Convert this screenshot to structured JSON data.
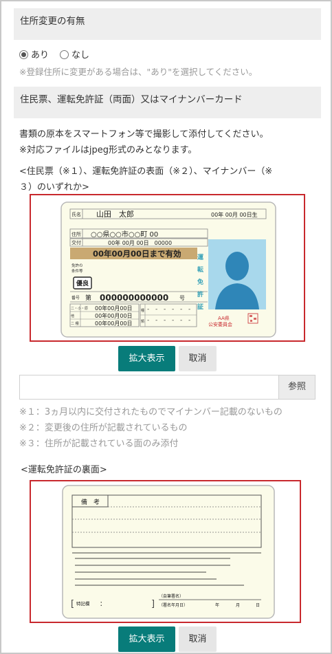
{
  "address_change": {
    "heading": "住所変更の有無",
    "options": [
      "あり",
      "なし"
    ],
    "selected": "あり",
    "note": "※登録住所に変更がある場合は、\"あり\"を選択してください。"
  },
  "documents": {
    "heading": "住民票、運転免許証（両面）又はマイナンバーカード",
    "instruction_1": "書類の原本をスマートフォン等で撮影して添付してください。",
    "instruction_2": "※対応ファイルはjpeg形式のみとなります。",
    "front_label_1": "<住民票（※１）、運転免許証の表面（※２）、マイナンバー（※",
    "front_label_2": "３）のいずれか>",
    "zoom_label": "拡大表示",
    "cancel_label": "取消",
    "browse_label": "参照",
    "file_value": "",
    "notes": [
      "※１：3ヵ月以内に交付されたものでマイナンバー記載のないもの",
      "※２：変更後の住所が記載されているもの",
      "※３：住所が記載されている面のみ添付"
    ],
    "back_label": "<運転免許証の裏面>"
  },
  "license_front": {
    "name_label": "氏名",
    "name": "山田　太郎",
    "birth": "00年 00月 00日生",
    "address_label": "住所",
    "address": "○○県○○市○○町 00",
    "issue_label": "交付",
    "issue": "00年 00月 00日　00000",
    "valid": "00年00月00日まで有効",
    "condition_label": "免許の\n条件等",
    "excellent": "優良",
    "number_label": "番号",
    "number_prefix": "第",
    "number": "000000000000",
    "number_suffix": "号",
    "history_rows": [
      "二・小・原",
      "他",
      "二 種"
    ],
    "history_dates": [
      "00年00月00日",
      "00年00月00日",
      "00年00月00日"
    ],
    "kind_label": "種類",
    "vertical_title": "運転免許証",
    "issuer_1": "AA県",
    "issuer_2": "公安委員会"
  },
  "license_back": {
    "remarks_label": "備　考",
    "special_label": "特記欄",
    "special_colon": "：",
    "sign_label": "（自筆署名）",
    "sign_date_label": "（署名年月日）",
    "year": "年",
    "month": "月",
    "day": "日"
  },
  "colors": {
    "accent": "#087c7a",
    "highlight_border": "#c8282d",
    "card_bg": "#fbfbe9",
    "photo_bg": "#a8d8ec"
  }
}
